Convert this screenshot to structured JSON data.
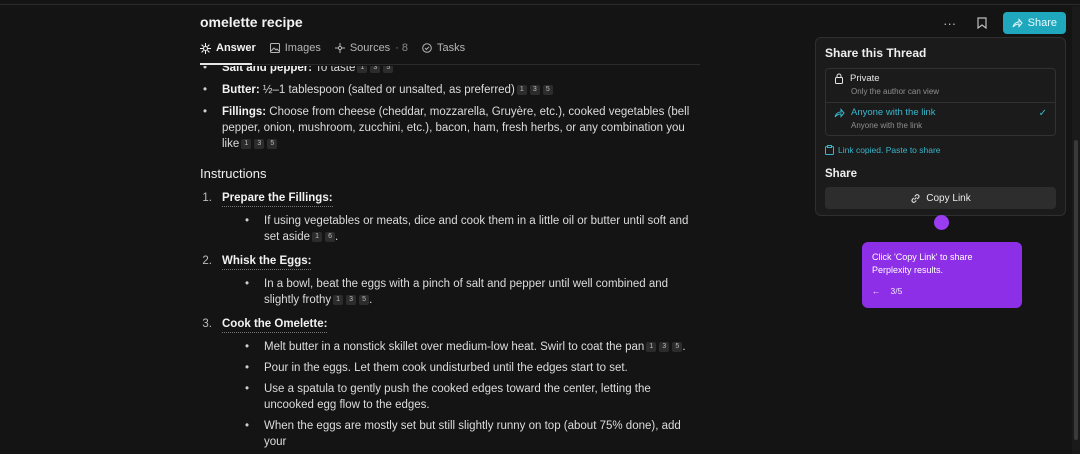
{
  "header": {
    "title": "omelette recipe",
    "more_label": "···",
    "share_label": "Share"
  },
  "tabs": [
    {
      "label": "Answer"
    },
    {
      "label": "Images"
    },
    {
      "label": "Sources",
      "count": "· 8"
    },
    {
      "label": "Tasks"
    }
  ],
  "ingredients": [
    {
      "bold": "Salt and pepper:",
      "text": " To taste",
      "cites": [
        "1",
        "3",
        "5"
      ]
    },
    {
      "bold": "Butter:",
      "text": " ½–1 tablespoon (salted or unsalted, as preferred)",
      "cites": [
        "1",
        "3",
        "5"
      ]
    },
    {
      "bold": "Fillings:",
      "text": " Choose from cheese (cheddar, mozzarella, Gruyère, etc.), cooked vegetables (bell pepper, onion, mushroom, zucchini, etc.), bacon, ham, fresh herbs, or any combination you like",
      "cites": [
        "1",
        "3",
        "5"
      ]
    }
  ],
  "instructions": {
    "heading": "Instructions",
    "steps": [
      {
        "num": "1.",
        "title": "Prepare the Fillings:",
        "bullets": [
          {
            "text": "If using vegetables or meats, dice and cook them in a little oil or butter until soft and set aside",
            "cites": [
              "1",
              "6"
            ],
            "end": "."
          }
        ]
      },
      {
        "num": "2.",
        "title": "Whisk the Eggs:",
        "bullets": [
          {
            "text": "In a bowl, beat the eggs with a pinch of salt and pepper until well combined and slightly frothy",
            "cites": [
              "1",
              "3",
              "5"
            ],
            "end": "."
          }
        ]
      },
      {
        "num": "3.",
        "title": "Cook the Omelette:",
        "bullets": [
          {
            "text": "Melt butter in a nonstick skillet over medium-low heat. Swirl to coat the pan",
            "cites": [
              "1",
              "3",
              "5"
            ],
            "end": "."
          },
          {
            "text": "Pour in the eggs. Let them cook undisturbed until the edges start to set.",
            "cites": [],
            "end": ""
          },
          {
            "text": "Use a spatula to gently push the cooked edges toward the center, letting the uncooked egg flow to the edges.",
            "cites": [],
            "end": ""
          },
          {
            "text": "When the eggs are mostly set but still slightly runny on top (about 75% done), add your",
            "cites": [],
            "end": ""
          }
        ]
      }
    ]
  },
  "share_panel": {
    "title": "Share this Thread",
    "options": [
      {
        "label": "Private",
        "desc": "Only the author can view",
        "selected": false
      },
      {
        "label": "Anyone with the link",
        "desc": "Anyone with the link",
        "selected": true
      }
    ],
    "copied_msg": "Link copied. Paste to share",
    "share_heading": "Share",
    "copy_button": "Copy Link"
  },
  "tooltip": {
    "text": "Click 'Copy Link' to share Perplexity results.",
    "back": "←",
    "progress": "3/5"
  },
  "colors": {
    "accent": "#1fa7bd",
    "tooltip": "#8c2fe6"
  }
}
